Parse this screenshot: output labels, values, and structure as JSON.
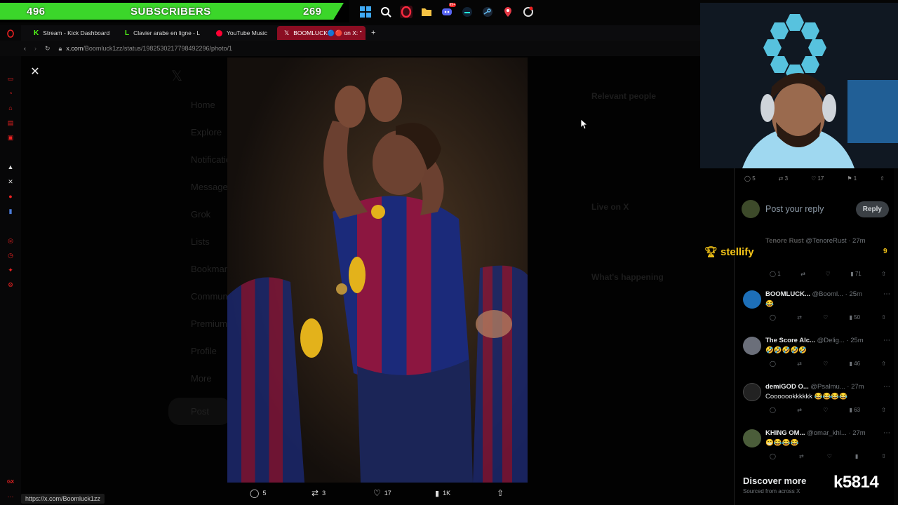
{
  "overlay": {
    "sub_left": "496",
    "sub_label": "SUBSCRIBERS",
    "sub_right": "269",
    "stellify_label": "stellify",
    "stellify_count": "9",
    "streamer_tag": "k5814"
  },
  "taskbar": {
    "icons": [
      "windows-icon",
      "search-icon",
      "opera-icon",
      "folder-icon",
      "discord-icon",
      "app-icon",
      "steam-icon",
      "location-icon",
      "settings-icon"
    ],
    "discord_badge": "99+"
  },
  "browser": {
    "tabs": [
      {
        "label": "Stream - Kick Dashboard",
        "icon": "kick-icon",
        "color": "#53fc18"
      },
      {
        "label": "Clavier arabe en ligne - L",
        "icon": "l-icon",
        "color": "#53fc18"
      },
      {
        "label": "YouTube Music",
        "icon": "youtube-music-icon",
        "color": "#ff0033"
      },
      {
        "label": "BOOMLUCK🔵🔴 on X: \"",
        "icon": "x-icon",
        "color": "#ffffff"
      }
    ],
    "url_domain": "x.com",
    "url_path": "/Boomluck1zz/status/1982530217798492296/photo/1",
    "status_url": "https://x.com/Boomluck1zz"
  },
  "x_background": {
    "nav": [
      "Home",
      "Explore",
      "Notifications",
      "Messages",
      "Grok",
      "Lists",
      "Bookmarks",
      "Communities",
      "Premium",
      "Profile",
      "More"
    ],
    "post_button": "Post",
    "relevant_people": "Relevant people",
    "live_on_x": "Live on X",
    "whats_happening": "What's happening"
  },
  "photo_actions": {
    "replies": "5",
    "reposts": "3",
    "likes": "17",
    "views": "1K"
  },
  "tweet_actions": {
    "replies": "5",
    "reposts": "3",
    "likes": "17",
    "bookmarks": "1"
  },
  "composer": {
    "placeholder": "Post your reply",
    "reply_label": "Reply"
  },
  "replies": [
    {
      "name": "Tenore Rust",
      "handle": "@TenoreRust",
      "time": "· 27m",
      "text": "",
      "comments": "1",
      "views": "71"
    },
    {
      "name": "BOOMLUCK...",
      "handle": "@Booml...",
      "time": "· 25m",
      "text": "😂",
      "comments": "",
      "views": "50",
      "avatar_color": "#1d6fb8"
    },
    {
      "name": "The Score Alc...",
      "handle": "@Delig...",
      "time": "· 25m",
      "text": "🤣🤣🤣🤣🤣",
      "comments": "",
      "views": "46",
      "avatar_color": "#6b6f7a"
    },
    {
      "name": "demiGOD O...",
      "handle": "@Psalmu...",
      "time": "· 27m",
      "text": "Cooooookkkkkk 😂😂😂😂",
      "comments": "",
      "views": "63",
      "avatar_color": "#222222"
    },
    {
      "name": "KHING OM...",
      "handle": "@omar_khl...",
      "time": "· 27m",
      "text": "😁😂😂😂",
      "comments": "",
      "views": "",
      "avatar_color": "#4b5d3a"
    }
  ],
  "discover": {
    "title": "Discover more",
    "subtitle": "Sourced from across X"
  },
  "colors": {
    "sub_green": "#3bd62a",
    "active_tab": "#8b0d22",
    "opera_red": "#e22222",
    "stellify_gold": "#f5c518"
  }
}
